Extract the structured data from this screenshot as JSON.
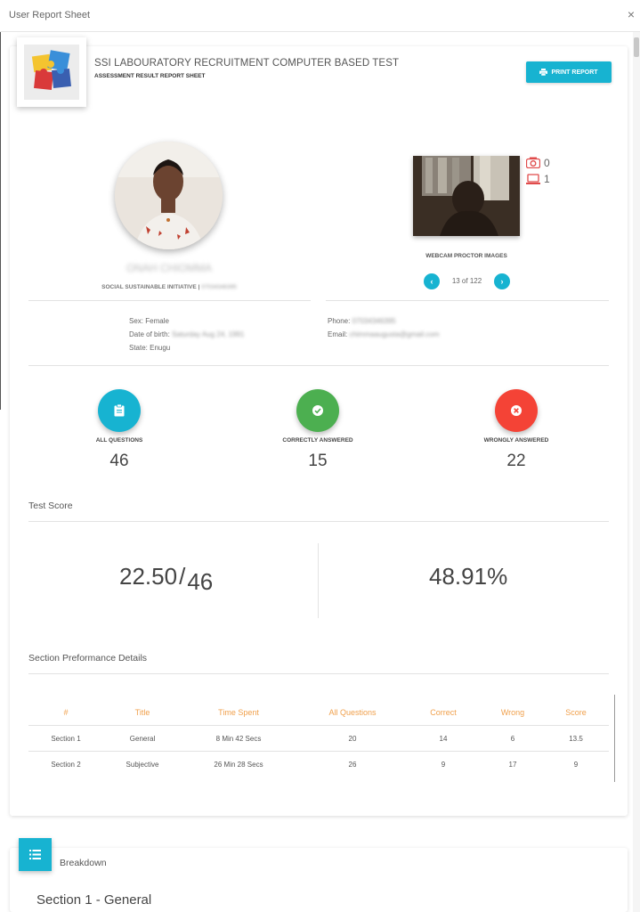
{
  "window": {
    "title": "User Report Sheet",
    "close_glyph": "×"
  },
  "header": {
    "org_title": "SSI LABOURATORY RECRUITMENT COMPUTER BASED TEST",
    "subtitle": "ASSESSMENT RESULT REPORT SHEET",
    "print_label": "PRINT REPORT"
  },
  "profile": {
    "name": "ONAH CHIOMMA",
    "organization": "SOCIAL SUSTAINABLE INITIATIVE",
    "org_separator": " | ",
    "org_phone": "07034346395",
    "sex_label": "Sex: ",
    "sex": "Female",
    "dob_label": "Date of birth: ",
    "dob": "Saturday Aug 24, 1991",
    "state_label": "State: ",
    "state": "Enugu",
    "phone_label": "Phone: ",
    "phone": "07034346395",
    "email_label": "Email: ",
    "email": "chimmaaugusta@gmail.com"
  },
  "proctor": {
    "camera_count": "0",
    "screen_count": "1",
    "label": "WEBCAM PROCTOR IMAGES",
    "pager": "13 of 122"
  },
  "stats": [
    {
      "label": "ALL QUESTIONS",
      "value": "46",
      "color": "#17b3d1",
      "icon": "clipboard-icon"
    },
    {
      "label": "CORRECTLY ANSWERED",
      "value": "15",
      "color": "#4caf50",
      "icon": "check-icon"
    },
    {
      "label": "WRONGLY ANSWERED",
      "value": "22",
      "color": "#f44336",
      "icon": "cross-icon"
    }
  ],
  "test_score": {
    "heading": "Test Score",
    "score": "22.50",
    "total": "46",
    "separator": "/",
    "percent": "48.91%"
  },
  "section_details": {
    "heading": "Section Preformance Details",
    "columns": [
      "#",
      "Title",
      "Time Spent",
      "All Questions",
      "Correct",
      "Wrong",
      "Score"
    ],
    "rows": [
      [
        "Section 1",
        "General",
        "8 Min 42 Secs",
        "20",
        "14",
        "6",
        "13.5"
      ],
      [
        "Section 2",
        "Subjective",
        "26 Min 28 Secs",
        "26",
        "9",
        "17",
        "9"
      ]
    ]
  },
  "breakdown": {
    "label": "Breakdown",
    "section_title": "Section 1 - General"
  },
  "colors": {
    "accent": "#17b3d1",
    "success": "#4caf50",
    "danger": "#f44336",
    "table_header": "#f0a04c"
  }
}
